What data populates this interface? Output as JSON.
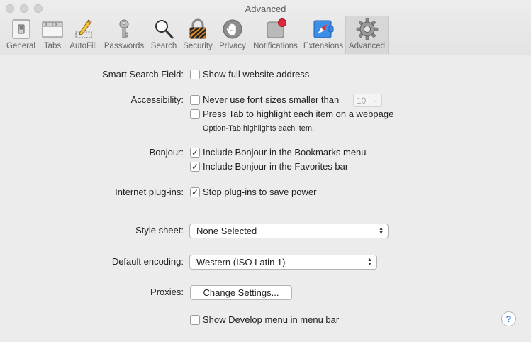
{
  "window": {
    "title": "Advanced"
  },
  "tabs": [
    {
      "label": "General",
      "icon": "general-switch-icon"
    },
    {
      "label": "Tabs",
      "icon": "tabs-icon"
    },
    {
      "label": "AutoFill",
      "icon": "autofill-pencil-icon"
    },
    {
      "label": "Passwords",
      "icon": "key-icon"
    },
    {
      "label": "Search",
      "icon": "magnifier-icon"
    },
    {
      "label": "Security",
      "icon": "lock-icon"
    },
    {
      "label": "Privacy",
      "icon": "hand-icon"
    },
    {
      "label": "Notifications",
      "icon": "notification-badge-icon"
    },
    {
      "label": "Extensions",
      "icon": "compass-icon"
    },
    {
      "label": "Advanced",
      "icon": "gear-icon",
      "selected": true
    }
  ],
  "smart_search": {
    "label": "Smart Search Field:",
    "option": "Show full website address",
    "checked": false
  },
  "accessibility": {
    "label": "Accessibility:",
    "font_option": "Never use font sizes smaller than",
    "font_checked": false,
    "font_size": "10",
    "tab_option": "Press Tab to highlight each item on a webpage",
    "tab_checked": false,
    "tab_note": "Option-Tab highlights each item."
  },
  "bonjour": {
    "label": "Bonjour:",
    "bookmarks_option": "Include Bonjour in the Bookmarks menu",
    "bookmarks_checked": true,
    "favorites_option": "Include Bonjour in the Favorites bar",
    "favorites_checked": true
  },
  "plugins": {
    "label": "Internet plug-ins:",
    "option": "Stop plug-ins to save power",
    "checked": true
  },
  "style_sheet": {
    "label": "Style sheet:",
    "value": "None Selected"
  },
  "encoding": {
    "label": "Default encoding:",
    "value": "Western (ISO Latin 1)"
  },
  "proxies": {
    "label": "Proxies:",
    "button": "Change Settings..."
  },
  "develop": {
    "option": "Show Develop menu in menu bar",
    "checked": false
  },
  "help": {
    "label": "?"
  },
  "check_mark": "✓",
  "colors": {
    "accent": "#3b7bd9",
    "badge": "#e0263b",
    "background": "#ececec"
  }
}
